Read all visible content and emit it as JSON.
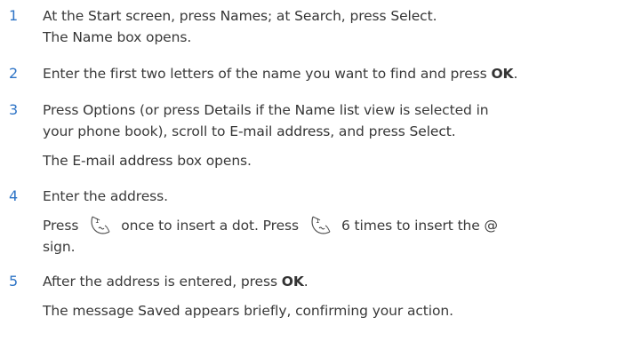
{
  "steps": [
    {
      "number": "1",
      "line1": {
        "a": "At the ",
        "start_screen": "Start screen",
        "b": ", press ",
        "names": "Names",
        "c": "; at ",
        "search": "Search",
        "d": ", press ",
        "select": "Select",
        "e": "."
      },
      "line2": {
        "a": "The ",
        "name": "Name",
        "b": " box opens."
      }
    },
    {
      "number": "2",
      "line1": {
        "a": "Enter the first two letters of the name you want to find and press ",
        "ok": "OK",
        "b": "."
      }
    },
    {
      "number": "3",
      "line1": {
        "a": "Press ",
        "options": "Options",
        "b": " (or press ",
        "details": "Details",
        "c": " if the ",
        "name_list": "Name list",
        "d": " view is selected in"
      },
      "line2": {
        "a": "your phone book), scroll to ",
        "email": "E-mail address",
        "b": ", and press ",
        "select": "Select",
        "c": "."
      },
      "line3": {
        "a": "The ",
        "email": "E-mail address",
        "b": " box opens."
      }
    },
    {
      "number": "4",
      "line1": {
        "text": "Enter the address."
      },
      "line2": {
        "a": "Press",
        "b": "once to insert a dot. Press",
        "c": "6 times to insert the @"
      },
      "line3": {
        "text": "sign."
      },
      "key_icon": "phone-key-1-icon"
    },
    {
      "number": "5",
      "line1": {
        "a": "After the address is entered, press ",
        "ok": "OK",
        "b": "."
      },
      "line2": {
        "a": "The message ",
        "saved": "Saved",
        "b": " appears briefly, confirming your action."
      }
    }
  ],
  "colors": {
    "step_number": "#2e74c6",
    "text": "#3a3a3a"
  }
}
